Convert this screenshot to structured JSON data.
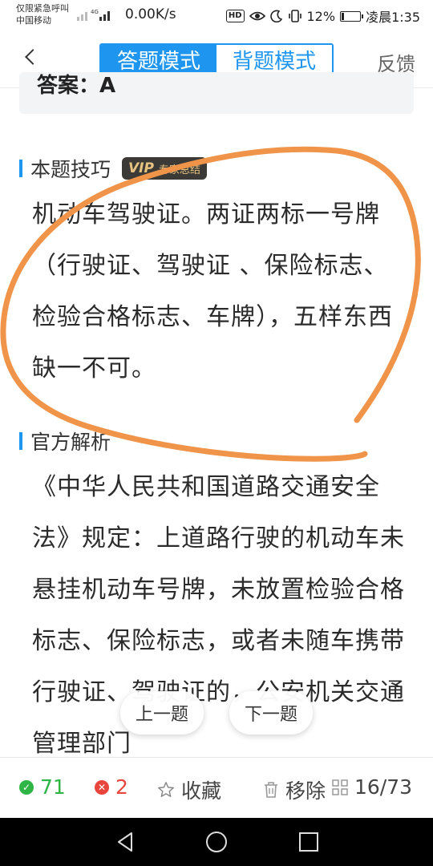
{
  "status_bar": {
    "emergency_text": "仅限紧急呼叫",
    "carrier": "中国移动",
    "network_speed": "0.00K/s",
    "battery": "12%",
    "time": "凌晨1:35"
  },
  "header": {
    "tabs": [
      {
        "label": "答题模式",
        "active": true
      },
      {
        "label": "背题模式",
        "active": false
      }
    ],
    "feedback_label": "反馈"
  },
  "answer": {
    "text": "答案：A"
  },
  "tip_section": {
    "title": "本题技巧",
    "vip_mark": "VIP",
    "vip_label": "专家总结",
    "body": "机动车驾驶证。两证两标一号牌（行驶证、驾驶证 、保险标志、检验合格标志、车牌），五样东西缺一不可。"
  },
  "official_section": {
    "title": "官方解析",
    "body": "《中华人民共和国道路交通安全法》规定：上道路行驶的机动车未悬挂机动车号牌，未放置检验合格标志、保险标志，或者未随车携带行驶证、驾驶证的，公安机关交通管理部门"
  },
  "float_buttons": {
    "prev": "上一题",
    "next": "下一题"
  },
  "toolbar": {
    "correct_count": "71",
    "wrong_count": "2",
    "favorite_label": "收藏",
    "remove_label": "移除",
    "progress": "16/73"
  },
  "colors": {
    "accent": "#1e96f0",
    "correct": "#2fb545",
    "wrong": "#e8453c",
    "annotation": "#f0944a"
  }
}
